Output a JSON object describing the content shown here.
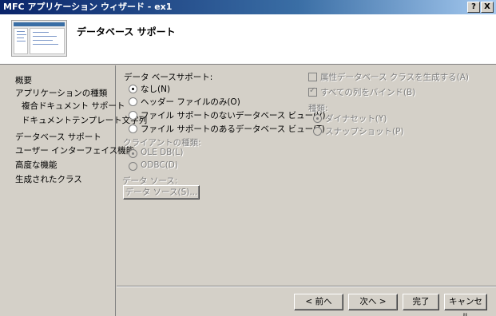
{
  "window": {
    "title": "MFC アプリケーション ウィザード - ex1",
    "help_btn": "?",
    "close_btn": "X"
  },
  "header": {
    "title": "データベース サポート"
  },
  "nav": {
    "items": [
      {
        "label": "概要"
      },
      {
        "label": "アプリケーションの種類"
      },
      {
        "label": "複合ドキュメント サポート"
      },
      {
        "label": "ドキュメントテンプレート文字列"
      },
      {
        "label": "データベース サポート"
      },
      {
        "label": "ユーザー インターフェイス機能"
      },
      {
        "label": "高度な機能"
      },
      {
        "label": "生成されたクラス"
      }
    ]
  },
  "db_support": {
    "heading": "データ ベースサポート:",
    "options": [
      {
        "label": "なし(N)",
        "selected": true
      },
      {
        "label": "ヘッダー ファイルのみ(O)",
        "selected": false
      },
      {
        "label": "ファイル サポートのないデータベース ビュー(V)",
        "selected": false
      },
      {
        "label": "ファイル サポートのあるデータベース ビュー(T)",
        "selected": false
      }
    ]
  },
  "client_type": {
    "heading": "クライアントの種類:",
    "options": [
      {
        "label": "OLE DB(L)",
        "selected": true
      },
      {
        "label": "ODBC(D)",
        "selected": false
      }
    ]
  },
  "data_source": {
    "heading": "データ ソース:",
    "button": "データ ソース(S)..."
  },
  "right_panel": {
    "attr_class_label": "属性データベース クラスを生成する(A)",
    "attr_class_checked": false,
    "bind_all_label": "すべての列をバインド(B)",
    "bind_all_checked": true,
    "type_heading": "種類:",
    "type_options": [
      {
        "label": "ダイナセット(Y)",
        "selected": true
      },
      {
        "label": "スナップショット(P)",
        "selected": false
      }
    ]
  },
  "footer": {
    "back": "< 前へ",
    "next": "次へ >",
    "finish": "完了",
    "cancel": "キャンセル"
  }
}
